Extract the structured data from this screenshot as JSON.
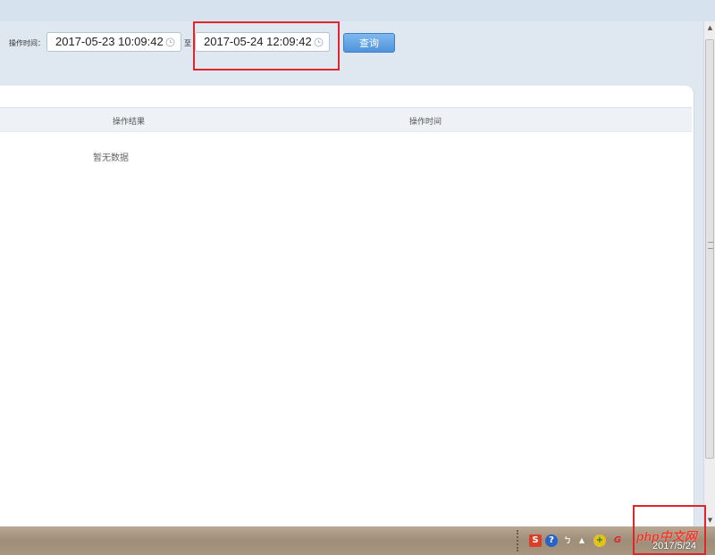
{
  "filter": {
    "label": "操作时间：",
    "start": "2017-05-23 10:09:42",
    "to": "至",
    "end": "2017-05-24 12:09:42",
    "query_button": "查询"
  },
  "table": {
    "columns": [
      "操作结果",
      "操作时间"
    ],
    "empty_text": "暂无数据"
  },
  "taskbar": {
    "date": "2017/5/24",
    "watermark": "php中文网"
  },
  "colors": {
    "highlight": "#e0252b",
    "button": "#4f93dc"
  }
}
